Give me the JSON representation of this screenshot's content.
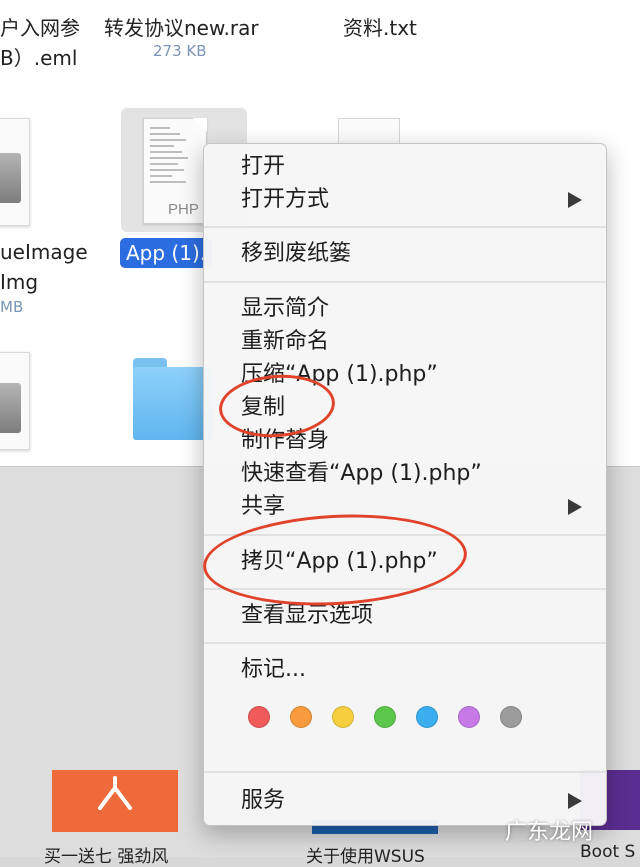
{
  "finder": {
    "files_top": [
      {
        "name_line1": "户入网参",
        "name_line2": "B）.eml"
      },
      {
        "name": "转发协议new.rar",
        "size": "273 KB"
      },
      {
        "name": "资料.txt"
      }
    ],
    "file_left_mid": {
      "name_line1": "ueImage",
      "name_line2": "Img",
      "size": "MB"
    },
    "selected_file": {
      "name": "App (1).",
      "type_tag": "PHP"
    }
  },
  "context_menu": {
    "items": [
      {
        "label": "打开"
      },
      {
        "label": "打开方式",
        "submenu": true
      },
      {
        "label": "移到废纸篓"
      },
      {
        "label": "显示简介"
      },
      {
        "label": "重新命名"
      },
      {
        "label": "压缩“App (1).php”"
      },
      {
        "label": "复制"
      },
      {
        "label": "制作替身"
      },
      {
        "label": "快速查看“App (1).php”"
      },
      {
        "label": "共享",
        "submenu": true
      },
      {
        "label": "拷贝“App (1).php”"
      },
      {
        "label": "查看显示选项"
      },
      {
        "label": "标记..."
      },
      {
        "label": "服务",
        "submenu": true
      }
    ],
    "tag_colors": [
      "#f05a5a",
      "#f79b3c",
      "#f6cf3e",
      "#5cc84b",
      "#3aaeef",
      "#c77ae6",
      "#9c9c9c"
    ]
  },
  "background": {
    "bottom_labels": [
      "买一送七 强劲风",
      "关于使用WSUS",
      "Boot S"
    ]
  },
  "annotations": {
    "highlight_color": "#e0432a"
  },
  "watermark": "广东龙网"
}
